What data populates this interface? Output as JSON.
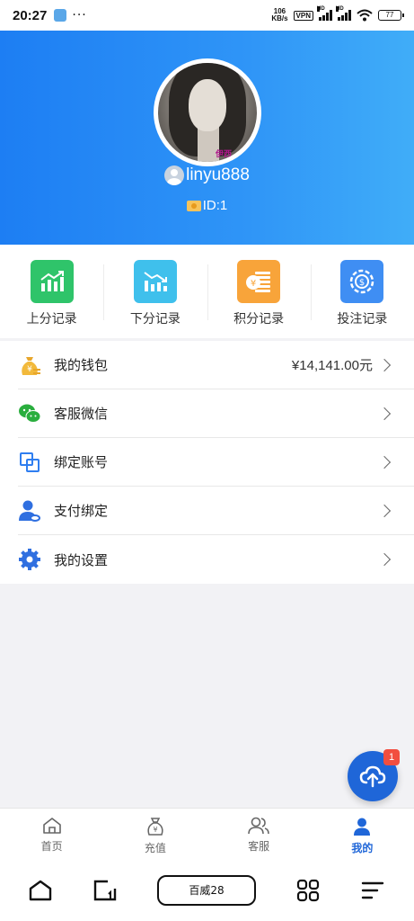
{
  "status_bar": {
    "time": "20:27",
    "dots": "···",
    "net_speed_value": "106",
    "net_speed_unit": "KB/s",
    "vpn": "VPN",
    "hd": "HD",
    "battery": "77"
  },
  "profile": {
    "avatar_mark": "伊西",
    "username": "linyu888",
    "id_label": "ID:1"
  },
  "quick_actions": [
    {
      "label": "上分记录",
      "color": "#2fc46a",
      "icon": "chart-up-icon"
    },
    {
      "label": "下分记录",
      "color": "#3fc0ec",
      "icon": "chart-down-icon"
    },
    {
      "label": "积分记录",
      "color": "#f8a43a",
      "icon": "coin-stack-icon"
    },
    {
      "label": "投注记录",
      "color": "#3f8ef3",
      "icon": "bet-coin-icon"
    }
  ],
  "menu": {
    "wallet": {
      "label": "我的钱包",
      "value": "¥14,141.00元",
      "icon": "money-bag-icon",
      "color": "#f2b93b"
    },
    "wechat": {
      "label": "客服微信",
      "icon": "wechat-icon",
      "color": "#2aae3e"
    },
    "bind_account": {
      "label": "绑定账号",
      "icon": "link-account-icon",
      "color": "#2f7ef0"
    },
    "payment_bind": {
      "label": "支付绑定",
      "icon": "user-link-icon",
      "color": "#2f6fe0"
    },
    "settings": {
      "label": "我的设置",
      "icon": "gear-icon",
      "color": "#2f6fe0"
    }
  },
  "fab": {
    "badge": "1",
    "icon": "cloud-upload-icon"
  },
  "tabs": [
    {
      "label": "首页",
      "icon": "home-icon"
    },
    {
      "label": "充值",
      "icon": "recharge-icon"
    },
    {
      "label": "客服",
      "icon": "customer-service-icon"
    },
    {
      "label": "我的",
      "icon": "profile-icon",
      "active": true
    }
  ],
  "system_nav": {
    "center_label": "百威28"
  },
  "colors": {
    "header_start": "#1d7ef3",
    "header_end": "#40adf8",
    "accent": "#1f66d8"
  }
}
